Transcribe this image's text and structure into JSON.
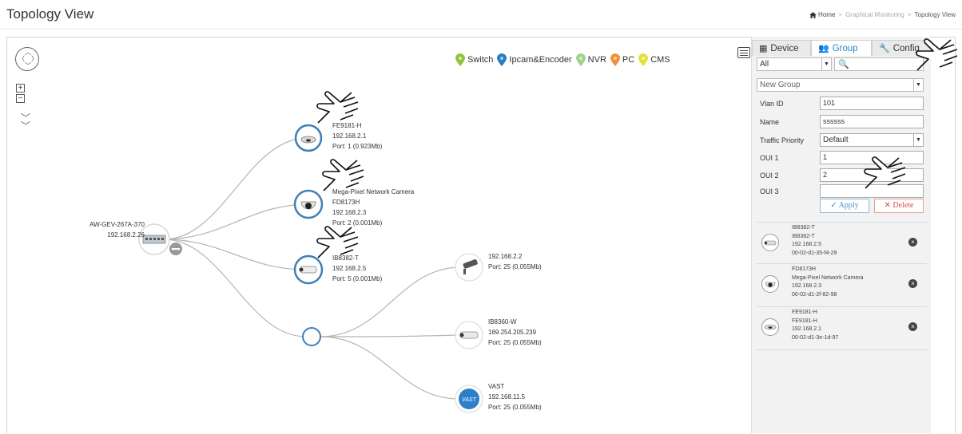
{
  "page": {
    "title": "Topology View",
    "breadcrumb": {
      "home": "Home",
      "sep": ">",
      "middle": "Graphical Monitoring",
      "current": "Topology View"
    }
  },
  "legend": [
    {
      "label": "Switch",
      "color": "#8fc53a"
    },
    {
      "label": "Ipcam&Encoder",
      "color": "#2a7cc0"
    },
    {
      "label": "NVR",
      "color": "#9fd38a"
    },
    {
      "label": "PC",
      "color": "#f0913a"
    },
    {
      "label": "CMS",
      "color": "#e6e136"
    }
  ],
  "topology": {
    "root": {
      "name": "AW-GEV-267A-370",
      "ip": "192.168.2.26"
    },
    "cams": [
      {
        "name": "FE9181-H",
        "ip": "192.168.2.1",
        "port": "Port: 1 (0.923Mb)"
      },
      {
        "name": "Mega-Pixel Network Camera",
        "model": "FD8173H",
        "ip": "192.168.2.3",
        "port": "Port: 2 (0.001Mb)"
      },
      {
        "name": "IB8382-T",
        "ip": "192.168.2.5",
        "port": "Port: 5 (0.001Mb)"
      }
    ],
    "leaves": [
      {
        "name": "",
        "ip": "192.168.2.2",
        "port": "Port: 25 (0.055Mb)"
      },
      {
        "name": "IB8360-W",
        "ip": "169.254.205.239",
        "port": "Port: 25 (0.055Mb)"
      },
      {
        "name": "VAST",
        "ip": "192.168.11.5",
        "port": "Port: 25 (0.055Mb)"
      }
    ]
  },
  "panel": {
    "tabs": [
      {
        "label": "Device",
        "icon": "grid-icon"
      },
      {
        "label": "Group",
        "icon": "users-icon"
      },
      {
        "label": "Config",
        "icon": "wrench-icon"
      }
    ],
    "filter": "All",
    "group_select": "New Group",
    "fields": [
      {
        "label": "Vlan ID",
        "value": "101"
      },
      {
        "label": "Name",
        "value": "ssssss"
      },
      {
        "label": "Traffic Priority",
        "value": "Default"
      },
      {
        "label": "OUI 1",
        "value": "1"
      },
      {
        "label": "OUI 2",
        "value": "2"
      },
      {
        "label": "OUI 3",
        "value": ""
      }
    ],
    "apply": "Apply",
    "apply_icon": "✓",
    "delete": "Delete",
    "delete_icon": "✕",
    "members": [
      {
        "name": "IB8382-T",
        "model": "IB8382-T",
        "ip": "192.168.2.5",
        "mac": "00-02-d1-35-f4-29"
      },
      {
        "name": "FD8173H",
        "model": "Mega-Pixel Network Camera",
        "ip": "192.168.2.3",
        "mac": "00-02-d1-2f-82-98"
      },
      {
        "name": "FE9181-H",
        "model": "FE9181-H",
        "ip": "192.168.2.1",
        "mac": "00-02-d1-3e-1d-97"
      }
    ]
  }
}
